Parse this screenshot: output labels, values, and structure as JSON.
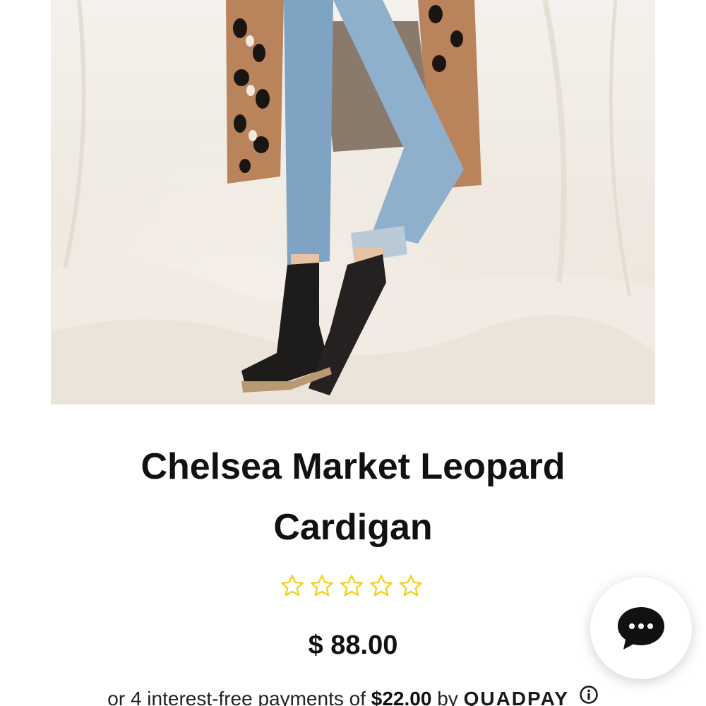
{
  "product": {
    "title": "Chelsea Market Leopard Cardigan",
    "rating_stars": 5,
    "rating_value": 0,
    "star_color": "#f2d31b",
    "price": "$ 88.00"
  },
  "installments": {
    "prefix": "or 4 interest-free payments of",
    "amount": "$22.00",
    "by": "by",
    "provider": "QUADPAY"
  },
  "icons": {
    "chat": "chat-bubble-icon",
    "info": "info-circle-icon",
    "star": "star-outline-icon"
  }
}
